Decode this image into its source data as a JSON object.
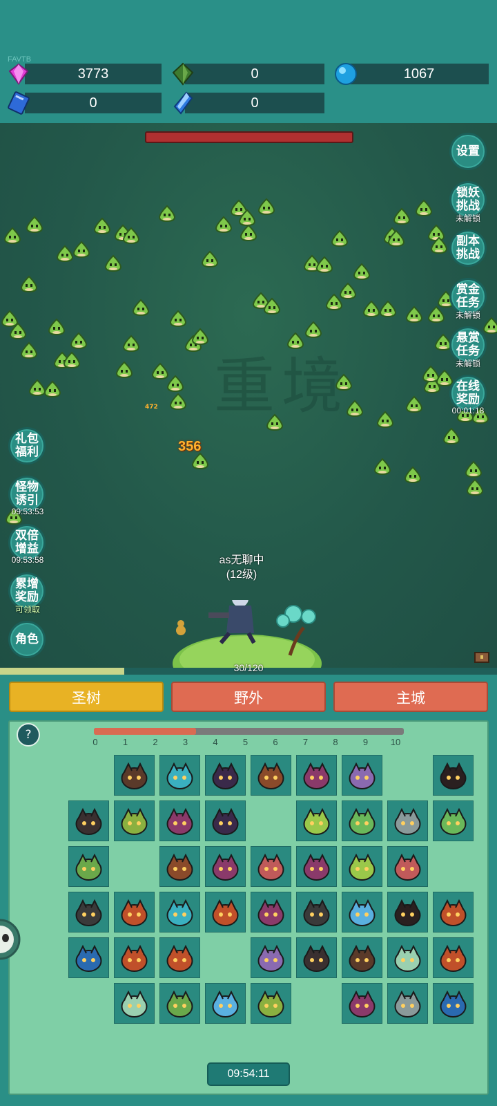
{
  "header": {
    "tag": "FAVTB",
    "resources": [
      {
        "icon": "pink-gem-icon",
        "value": "3773"
      },
      {
        "icon": "green-crystal-icon",
        "value": "0"
      },
      {
        "icon": "blue-orb-icon",
        "value": "1067"
      },
      {
        "icon": "blue-book-icon",
        "value": "0"
      },
      {
        "icon": "blue-shard-icon",
        "value": "0"
      }
    ]
  },
  "field": {
    "watermark": "重境",
    "damage_big": "356",
    "damage_small": "472",
    "player": {
      "name": "as无聊中",
      "level": "(12级)"
    },
    "xp_text": "30/120",
    "xp_progress": 0.25
  },
  "right_buttons": [
    {
      "label": "设置",
      "sub": ""
    },
    {
      "label": "锁妖挑战",
      "sub": "未解锁"
    },
    {
      "label": "副本挑战",
      "sub": ""
    },
    {
      "label": "赏金任务",
      "sub": "未解锁"
    },
    {
      "label": "悬赏任务",
      "sub": "未解锁"
    },
    {
      "label": "在线奖励",
      "sub": "00:01:18"
    }
  ],
  "left_buttons": [
    {
      "label": "礼包福利",
      "sub": ""
    },
    {
      "label": "怪物诱引",
      "sub": "09:53:53"
    },
    {
      "label": "双倍增益",
      "sub": "09:53:58"
    },
    {
      "label": "累增奖励",
      "sub": "可领取"
    },
    {
      "label": "角色",
      "sub": ""
    }
  ],
  "tabs": [
    {
      "label": "圣树",
      "color": "#e8b224"
    },
    {
      "label": "野外",
      "color": "#df6b52"
    },
    {
      "label": "主城",
      "color": "#df6b52"
    }
  ],
  "panel": {
    "help": "?",
    "stage_ticks": [
      "0",
      "1",
      "2",
      "3",
      "4",
      "5",
      "6",
      "7",
      "8",
      "9",
      "10"
    ],
    "stage_progress": 0.33,
    "timer": "09:54:11",
    "grid": [
      [
        "",
        "spider",
        "horned-blue",
        "dark-blob",
        "bull",
        "spiky-purple",
        "purple-blob",
        "",
        "dark-hood"
      ],
      [
        "dark-witch",
        "green-spike",
        "spiky-purple",
        "dark-blob",
        "",
        "leaf-bug",
        "green-turtle",
        "jellyfish",
        "green-turtle"
      ],
      [
        "alien",
        "",
        "bull",
        "spiky-purple",
        "crow",
        "spiky-purple",
        "leaf-bug",
        "crow",
        ""
      ],
      [
        "bat-hat",
        "lava-hood",
        "horned-blue",
        "lava-hood",
        "spiky-purple",
        "bat-hat",
        "water-drop",
        "dark-hood",
        "lava-hood"
      ],
      [
        "fish",
        "lava-hood",
        "lava-hood",
        "",
        "purple-blob",
        "dark-witch",
        "spider",
        "green-bell",
        "lava-hood"
      ],
      [
        "",
        "green-bell",
        "alien",
        "water-drop",
        "green-spike",
        "",
        "spiky-purple",
        "jellyfish",
        "fish"
      ]
    ]
  }
}
